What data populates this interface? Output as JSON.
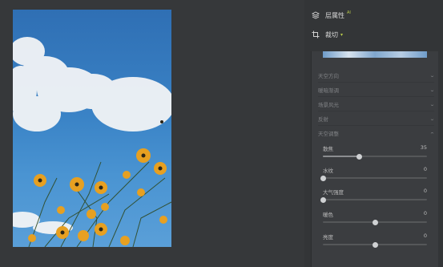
{
  "right_panel": {
    "layer_item": {
      "label": "层属性",
      "badge": "AI",
      "icon": "layers-icon"
    },
    "crop_item": {
      "label": "裁切",
      "icon": "crop-icon",
      "caret": "▾"
    }
  },
  "sections": [
    {
      "label": "天空方向"
    },
    {
      "label": "暖暗渐调"
    },
    {
      "label": "场景风光"
    },
    {
      "label": "反射"
    },
    {
      "label": "天空调整",
      "expanded": true
    }
  ],
  "sliders": [
    {
      "name": "散焦",
      "value": "35",
      "fraction": 0.35
    },
    {
      "name": "水纹",
      "value": "0",
      "fraction": 0.0
    },
    {
      "name": "大气强度",
      "value": "0",
      "fraction": 0.0
    },
    {
      "name": "暖色",
      "value": "0",
      "fraction": 0.5
    },
    {
      "name": "亮度",
      "value": "0",
      "fraction": 0.5
    }
  ],
  "colors": {
    "accent": "#b7c94a",
    "panel": "#3b3d40",
    "background": "#333537"
  }
}
